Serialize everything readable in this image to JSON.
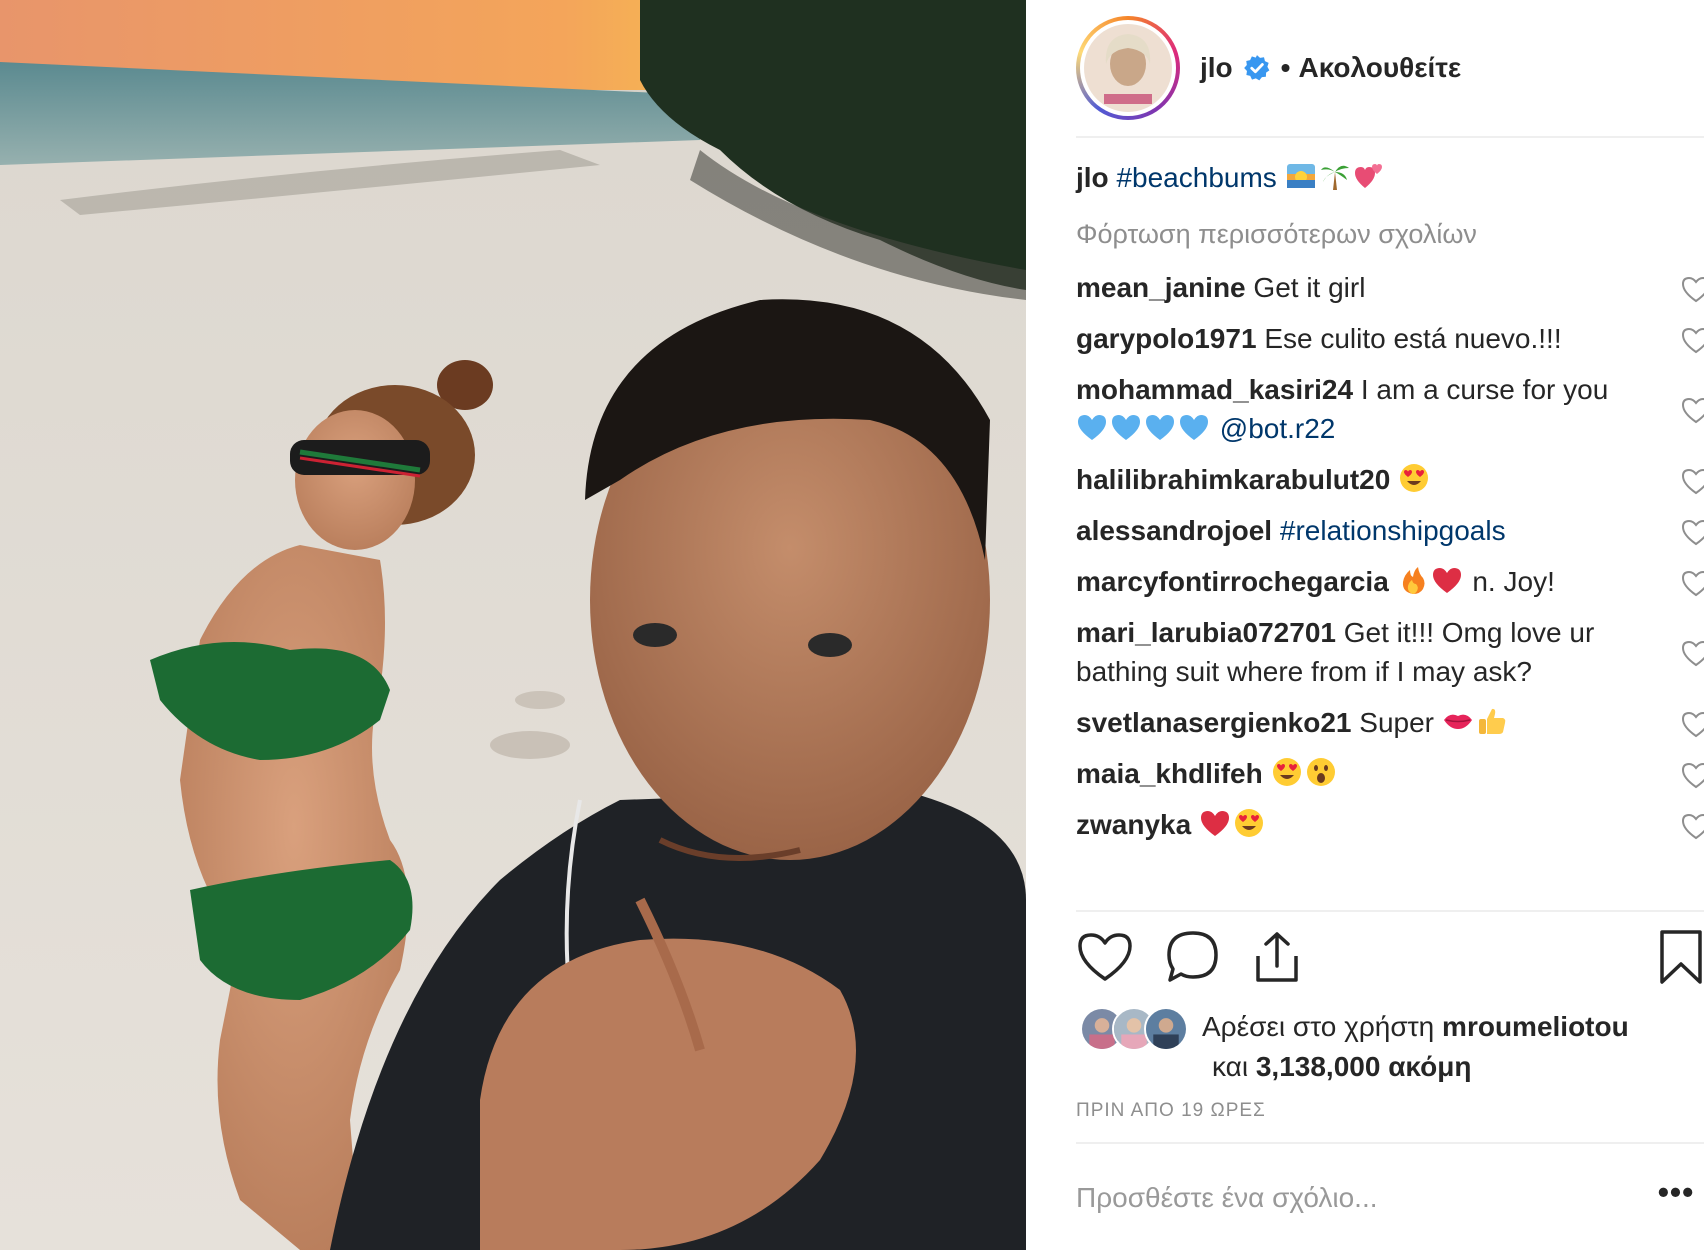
{
  "post": {
    "username": "jlo",
    "follow_label": "Ακολουθείτε",
    "separator": "•",
    "caption": {
      "username": "jlo",
      "hashtag": "#beachbums"
    },
    "load_more": "Φόρτωση περισσότερων σχολίων",
    "comments": [
      {
        "username": "mean_janine",
        "text": "Get it girl",
        "emojis": []
      },
      {
        "username": "garypolo1971",
        "text": "Ese culito está nuevo.!!!",
        "emojis": []
      },
      {
        "username": "mohammad_kasiri24",
        "text": "I am a curse for you",
        "emojis": [
          "blue-heart",
          "blue-heart",
          "blue-heart",
          "blue-heart"
        ],
        "mention": "@bot.r22"
      },
      {
        "username": "halilibrahimkarabulut20",
        "text": "",
        "emojis": [
          "heart-eyes"
        ]
      },
      {
        "username": "alessandrojoel",
        "text": "",
        "emojis": [],
        "hashtag": "#relationshipgoals"
      },
      {
        "username": "marcyfontirrochegarcia",
        "text": "",
        "emojis": [
          "fire",
          "red-heart"
        ],
        "after": "n. Joy!"
      },
      {
        "username": "mari_larubia072701",
        "text": "Get it!!! Omg love ur bathing suit where from if I may ask?",
        "emojis": []
      },
      {
        "username": "svetlanasergienko21",
        "text": "Super",
        "emojis": [
          "kiss-lips",
          "thumbs-up"
        ]
      },
      {
        "username": "maia_khdlifeh",
        "text": "",
        "emojis": [
          "heart-eyes",
          "surprised"
        ]
      },
      {
        "username": "zwanyka",
        "text": "",
        "emojis": [
          "red-heart",
          "heart-eyes"
        ]
      }
    ],
    "likes": {
      "prefix": "Αρέσει στο χρήστη",
      "user": "mroumeliotou",
      "line2_prefix": "και",
      "count": "3,138,000",
      "line2_suffix": "ακόμη"
    },
    "timestamp": "ΠΡΙΝ ΑΠΟ 19 ΩΡΕΣ",
    "add_comment_placeholder": "Προσθέστε ένα σχόλιο...",
    "more_options": "•••"
  },
  "colors": {
    "link": "#00376b",
    "verified": "#3897f0",
    "muted": "#8e8e8e",
    "text": "#262626",
    "divider": "#efefef"
  }
}
